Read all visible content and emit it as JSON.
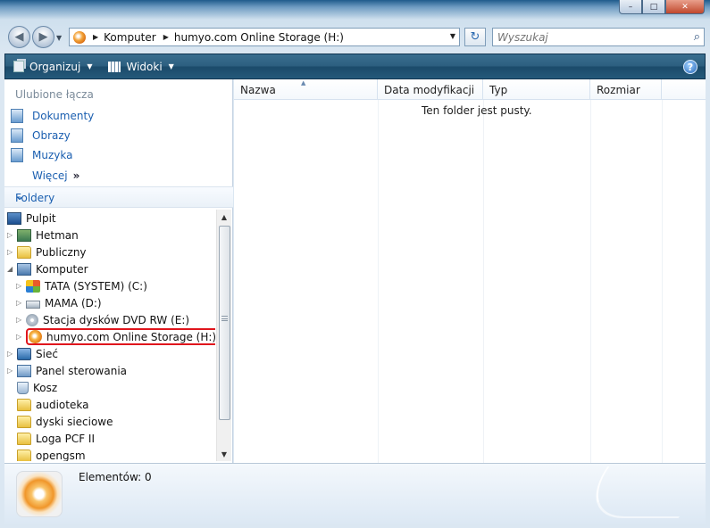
{
  "window": {
    "buttons": {
      "minimize": "–",
      "maximize": "□",
      "close": "✕"
    }
  },
  "nav": {
    "back": "◀",
    "forward": "▶",
    "address": {
      "segments": [
        "Komputer",
        "humyo.com Online Storage (H:)"
      ],
      "separator": "▶",
      "dropdown": "▼"
    },
    "refresh": "↻",
    "search_placeholder": "Wyszukaj",
    "search_icon": "⌕"
  },
  "toolbar": {
    "organize": "Organizuj",
    "views": "Widoki",
    "dropdown": "▼",
    "help": "?"
  },
  "sidebar": {
    "favorites_title": "Ulubione łącza",
    "favorites": [
      {
        "label": "Dokumenty",
        "icon": "documents-icon"
      },
      {
        "label": "Obrazy",
        "icon": "pictures-icon"
      },
      {
        "label": "Muzyka",
        "icon": "music-icon"
      }
    ],
    "more": "Więcej",
    "more_chevron": "»",
    "folders_title": "Foldery",
    "folders_chevron": "⌄",
    "tree": [
      {
        "label": "Pulpit",
        "icon": "desktop-icon",
        "level": 0,
        "expander": ""
      },
      {
        "label": "Hetman",
        "icon": "user-folder-icon",
        "level": 0,
        "expander": "▷"
      },
      {
        "label": "Publiczny",
        "icon": "folder-icon",
        "level": 0,
        "expander": "▷"
      },
      {
        "label": "Komputer",
        "icon": "computer-icon",
        "level": 0,
        "expander": "◢"
      },
      {
        "label": "TATA (SYSTEM) (C:)",
        "icon": "system-drive-icon",
        "level": 1,
        "expander": "▷"
      },
      {
        "label": "MAMA (D:)",
        "icon": "drive-icon",
        "level": 1,
        "expander": "▷"
      },
      {
        "label": "Stacja dysków DVD RW (E:)",
        "icon": "dvd-drive-icon",
        "level": 1,
        "expander": "▷"
      },
      {
        "label": "humyo.com Online Storage (H:)",
        "icon": "humyo-icon",
        "level": 1,
        "expander": "▷",
        "selected": true
      },
      {
        "label": "Sieć",
        "icon": "network-icon",
        "level": 0,
        "expander": "▷"
      },
      {
        "label": "Panel sterowania",
        "icon": "control-panel-icon",
        "level": 0,
        "expander": "▷"
      },
      {
        "label": "Kosz",
        "icon": "recycle-bin-icon",
        "level": 0,
        "expander": ""
      },
      {
        "label": "audioteka",
        "icon": "folder-icon",
        "level": 0,
        "expander": ""
      },
      {
        "label": "dyski sieciowe",
        "icon": "folder-icon",
        "level": 0,
        "expander": ""
      },
      {
        "label": "Loga PCF II",
        "icon": "folder-icon",
        "level": 0,
        "expander": ""
      },
      {
        "label": "opengsm",
        "icon": "folder-icon",
        "level": 0,
        "expander": ""
      }
    ],
    "scroll": {
      "up": "▲",
      "down": "▼"
    }
  },
  "content": {
    "columns": [
      "Nazwa",
      "Data modyfikacji",
      "Typ",
      "Rozmiar"
    ],
    "sort_indicator": "▲",
    "empty_message": "Ten folder jest pusty."
  },
  "details": {
    "elements_label": "Elementów: 0"
  }
}
